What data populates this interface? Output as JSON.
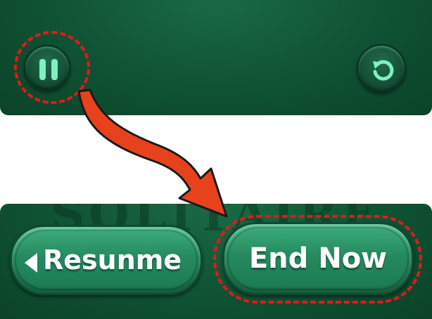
{
  "top_bar": {
    "pause_icon": "pause-icon",
    "restart_icon": "restart-icon"
  },
  "bottom_menu": {
    "resume_label": "Resunme",
    "resume_icon": "caret-left-icon",
    "end_now_label": "End Now"
  },
  "annotations": {
    "highlight_color": "#e21a1a",
    "arrow_fill": "#e8421c"
  },
  "colors": {
    "felt_green": "#0f5234",
    "button_green": "#258a5f"
  }
}
